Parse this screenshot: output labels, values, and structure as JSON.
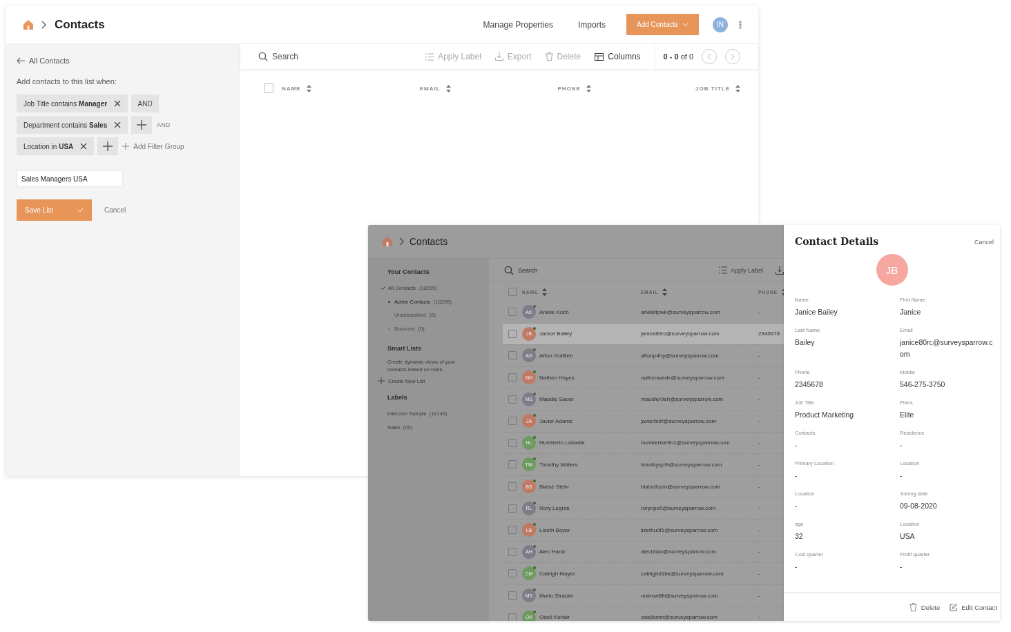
{
  "main_window": {
    "header": {
      "title": "Contacts",
      "nav": [
        "Manage Properties",
        "Imports"
      ],
      "primary_button": "Add Contacts",
      "avatar": "IN"
    },
    "filter_panel": {
      "back_link": "All Contacts",
      "intro": "Add contacts to this list when:",
      "conditions": [
        {
          "text": "Job Title contains **Manager**",
          "kind": "and_button",
          "connector": "AND"
        },
        {
          "text": "Department contains **Sales**",
          "kind": "and_text",
          "connector": "AND"
        },
        {
          "text": "Location in **USA**",
          "kind": "add_group",
          "connector": "Add Filter Group"
        }
      ],
      "list_name": "Sales Managers USA",
      "save_button": "Save List",
      "cancel": "Cancel"
    },
    "toolbar": {
      "search_placeholder": "Search",
      "actions": [
        {
          "label": "Apply Label",
          "disabled": true
        },
        {
          "label": "Export",
          "disabled": true
        },
        {
          "label": "Delete",
          "disabled": true
        },
        {
          "label": "Columns",
          "disabled": false
        }
      ],
      "range": "**0 - 0** of 0"
    },
    "table": {
      "columns": [
        "NAME",
        "EMAIL",
        "PHONE",
        "JOB TITLE"
      ],
      "select_all_checked": false
    }
  },
  "contacts_window": {
    "header": {
      "title": "Contacts"
    },
    "sidebar": {
      "sections": [
        {
          "title": "Your Contacts",
          "items": [
            {
              "label": "All Contacts",
              "count": "(18295)",
              "selected": true,
              "children": [
                {
                  "label": "Active Contacts",
                  "count": "(18295)",
                  "color": "#3a3a3a",
                  "disabled": false
                },
                {
                  "label": "Unsubscribed",
                  "count": "(0)",
                  "color": "#c9805e",
                  "disabled": true
                },
                {
                  "label": "Bounced",
                  "count": "(0)",
                  "color": "#7d7d7d",
                  "disabled": true
                }
              ]
            }
          ]
        },
        {
          "title": "Smart Lists",
          "description": "Create dynamic views of your contacts based on rules.",
          "link": "Create New List"
        },
        {
          "title": "Labels",
          "labels": [
            {
              "label": "Intercom Sample",
              "count": "(18148)"
            },
            {
              "label": "Sales",
              "count": "(50)"
            }
          ]
        }
      ]
    },
    "toolbar": {
      "search_placeholder": "Search",
      "action": "Apply Label"
    },
    "table": {
      "columns": [
        "NAME",
        "EMAIL",
        "PHONE"
      ],
      "select_all_checked": false,
      "rows": [
        {
          "initials": "AK",
          "color": "#7e7c88",
          "name": "Arielle Koch",
          "email": "arielletpwk@surveysparrow.com",
          "phone": "-",
          "selected": false,
          "checked": false
        },
        {
          "initials": "JB",
          "color": "#c07a63",
          "name": "Janice Bailey",
          "email": "janice80rc@surveysparrow.com",
          "phone": "2345678",
          "selected": true,
          "checked": false
        },
        {
          "initials": "AG",
          "color": "#7e7c88",
          "name": "Afton Gottlieb",
          "email": "aftonp4hp@surveysparrow.com",
          "phone": "-",
          "selected": false,
          "checked": false
        },
        {
          "initials": "NH",
          "color": "#c07a63",
          "name": "Nathen Hayes",
          "email": "nathenwede@surveysparrow.com",
          "phone": "-",
          "selected": false,
          "checked": false
        },
        {
          "initials": "MS",
          "color": "#7e7c88",
          "name": "Maudie Sauer",
          "email": "maudier9eh@surveysparrow.com",
          "phone": "-",
          "selected": false,
          "checked": false
        },
        {
          "initials": "JA",
          "color": "#c07a63",
          "name": "Javier Adams",
          "email": "javierfs9f@surveysparrow.com",
          "phone": "-",
          "selected": false,
          "checked": false
        },
        {
          "initials": "HL",
          "color": "#6f9a5f",
          "name": "Humberto Labadie",
          "email": "humbertoe9n1@surveysparrow.com",
          "phone": "-",
          "selected": false,
          "checked": false
        },
        {
          "initials": "TW",
          "color": "#6f9a5f",
          "name": "Timothy Waters",
          "email": "timothysp9i@surveysparrow.com",
          "phone": "-",
          "selected": false,
          "checked": false
        },
        {
          "initials": "BS",
          "color": "#c07a63",
          "name": "Blaise Stehr",
          "email": "blaisefozm@surveysparrow.com",
          "phone": "-",
          "selected": false,
          "checked": false
        },
        {
          "initials": "RL",
          "color": "#7e7c88",
          "name": "Rory Legros",
          "email": "rorynpv5@surveysparrow.com",
          "phone": "-",
          "selected": false,
          "checked": false
        },
        {
          "initials": "LB",
          "color": "#c07a63",
          "name": "Lizeth Boyer",
          "email": "lizethu0f1@surveysparrow.com",
          "phone": "-",
          "selected": false,
          "checked": false
        },
        {
          "initials": "AH",
          "color": "#7e7c88",
          "name": "Alec Hand",
          "email": "alechhzo@surveysparrow.com",
          "phone": "-",
          "selected": false,
          "checked": false
        },
        {
          "initials": "CM",
          "color": "#6f9a5f",
          "name": "Caleigh Mayer",
          "email": "caleighd1bk@surveysparrow.com",
          "phone": "-",
          "selected": false,
          "checked": false
        },
        {
          "initials": "MS",
          "color": "#7e7c88",
          "name": "Mario Stracke",
          "email": "mariow8ft@surveysparrow.com",
          "phone": "-",
          "selected": false,
          "checked": false
        },
        {
          "initials": "OK",
          "color": "#6f9a5f",
          "name": "Odell Kohler",
          "email": "odellkznh@surveysparrow.com",
          "phone": "-",
          "selected": false,
          "checked": false
        }
      ]
    }
  },
  "contact_details": {
    "title": "Contact Details",
    "cancel": "Cancel",
    "avatar": "JB",
    "fields": [
      {
        "label": "Name",
        "value": "Janice Bailey"
      },
      {
        "label": "First Name",
        "value": "Janice"
      },
      {
        "label": "Last Name",
        "value": "Bailey"
      },
      {
        "label": "Email",
        "value": "janice80rc@surveysparrow.com"
      },
      {
        "label": "Phone",
        "value": "2345678"
      },
      {
        "label": "Mobile",
        "value": "546-275-3750"
      },
      {
        "label": "Job Title",
        "value": "Product Marketing"
      },
      {
        "label": "Plans",
        "value": "Elite"
      },
      {
        "label": "Contacts",
        "value": "-"
      },
      {
        "label": "Residence",
        "value": "-"
      },
      {
        "label": "Primary Location",
        "value": "-"
      },
      {
        "label": "Location",
        "value": "-"
      },
      {
        "label": "Location",
        "value": "-"
      },
      {
        "label": "Joining date",
        "value": "09-08-2020"
      },
      {
        "label": "age",
        "value": "32"
      },
      {
        "label": "Location",
        "value": "USA"
      },
      {
        "label": "Cost quarter",
        "value": "-"
      },
      {
        "label": "Profit quarter",
        "value": "-"
      }
    ],
    "actions": [
      "Delete",
      "Edit Contact"
    ]
  }
}
